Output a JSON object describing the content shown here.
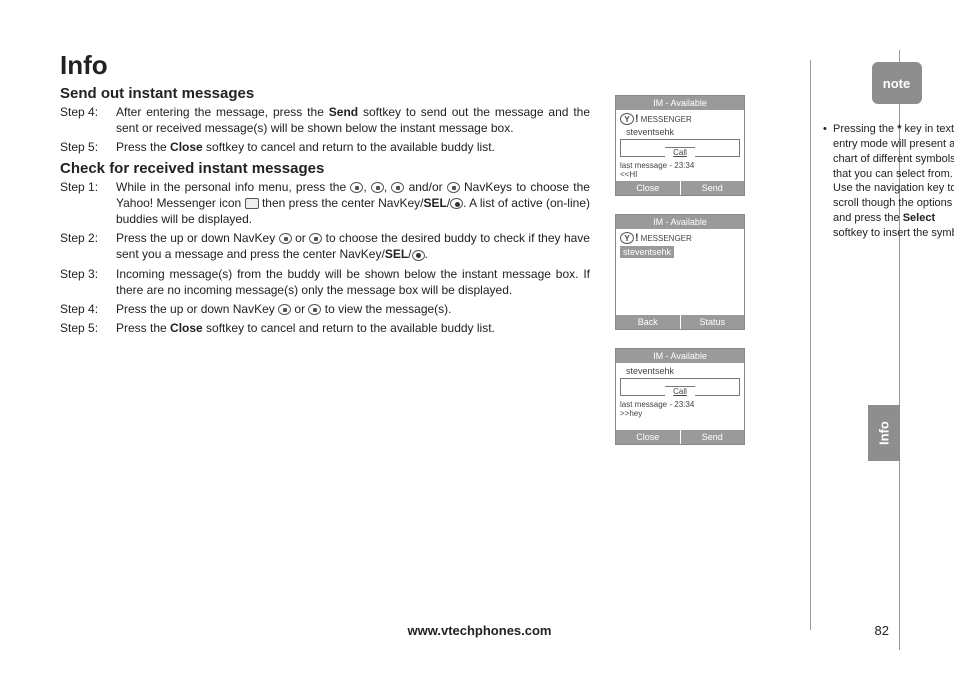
{
  "title": "Info",
  "section1": {
    "heading": "Send out instant messages",
    "steps": [
      {
        "label": "Step 4:",
        "html": "After entering the message, press the <b>Send</b> softkey to send out the message and the sent or received message(s) will be shown below the instant message box."
      },
      {
        "label": "Step 5:",
        "html": "Press the <b>Close</b> softkey to cancel and return to the available buddy list."
      }
    ]
  },
  "section2": {
    "heading": "Check for received instant messages",
    "steps": [
      {
        "label": "Step 1:",
        "html": "While in the personal info menu, press the <span class='navkey'></span>, <span class='navkey'></span>, <span class='navkey'></span> and/or <span class='navkey'></span> NavKeys to choose the Yahoo! Messenger icon <span class='yahoo-icon'></span> then press the center NavKey/<b>SEL</b>/<span class='navkey center'></span>. A list of active (on-line) buddies will be displayed."
      },
      {
        "label": "Step 2:",
        "html": "Press the up or down NavKey <span class='navkey'></span> or <span class='navkey'></span> to choose the desired buddy to check if they have sent you a message and press the center NavKey/<b>SEL</b>/<span class='navkey center'></span>."
      },
      {
        "label": "Step 3:",
        "html": "Incoming message(s) from the buddy will be shown below the instant message box. If there are no incoming message(s) only the message box will be displayed."
      },
      {
        "label": "Step 4:",
        "html": "Press the up or down NavKey <span class='navkey'></span> or <span class='navkey'></span> to view the message(s)."
      },
      {
        "label": "Step 5:",
        "html": "Press the <b>Close</b> softkey to cancel and return to the available buddy list."
      }
    ]
  },
  "phone1": {
    "title": "IM - Available",
    "brand": "MESSENGER",
    "user": "steventsehk",
    "call": "Call",
    "last": "last message - 23:34",
    "msg": "<<HI",
    "skLeft": "Close",
    "skRight": "Send"
  },
  "phone2": {
    "title": "IM - Available",
    "brand": "MESSENGER",
    "contact": "steventsehk",
    "skLeft": "Back",
    "skRight": "Status"
  },
  "phone3": {
    "title": "IM - Available",
    "user": "steventsehk",
    "call": "Call",
    "last": "last message - 23:34",
    "msg": ">>hey",
    "skLeft": "Close",
    "skRight": "Send"
  },
  "note": {
    "badge": "note",
    "html": "Pressing the <b>*</b> key in text entry mode will present a chart of different symbols that you can select from. Use the navigation key to scroll though the options and press the <b>Select</b> softkey to insert the symbol."
  },
  "footer": "www.vtechphones.com",
  "pageNum": "82",
  "sideTab": "Info"
}
